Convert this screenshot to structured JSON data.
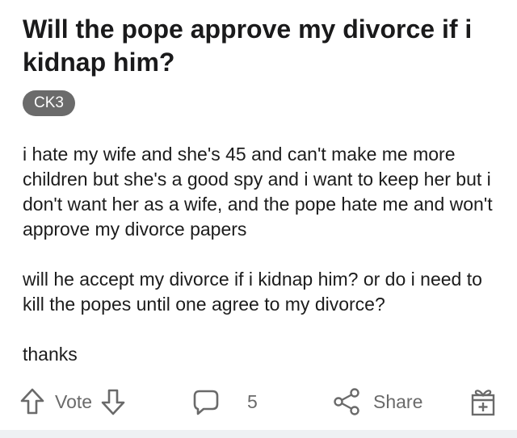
{
  "post": {
    "title": "Will the pope approve my divorce if i kidnap him?",
    "flair": "CK3",
    "body": [
      "i hate my wife and she's 45 and can't make me more children but she's a good spy and i want to keep her but i don't want her as a wife, and the pope hate me and won't approve my divorce papers",
      "will he accept my divorce if i kidnap him? or do i need to kill the popes until one agree to my divorce?",
      "thanks"
    ]
  },
  "actions": {
    "vote_label": "Vote",
    "comment_count": "5",
    "share_label": "Share",
    "icons": {
      "upvote": "upvote-arrow-icon",
      "downvote": "downvote-arrow-icon",
      "comment": "comment-bubble-icon",
      "share": "share-icon",
      "award": "award-gift-icon"
    }
  },
  "colors": {
    "flair_background": "#6b6b6b",
    "action_gray": "#6a6a6a",
    "bottom_strip": "#eef1f3"
  }
}
